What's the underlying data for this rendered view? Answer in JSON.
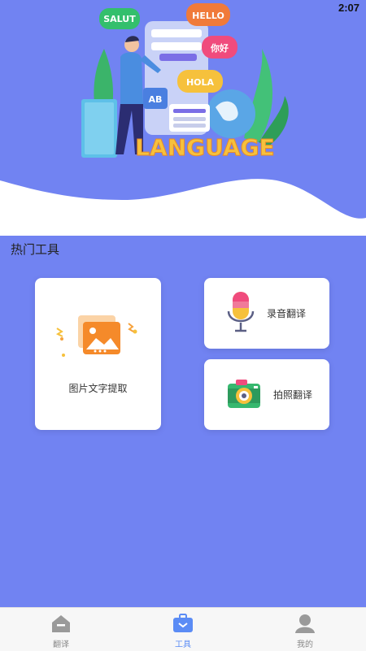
{
  "status_bar": {
    "time": "2:07"
  },
  "hero": {
    "bubbles": {
      "salut": "SALUT",
      "hello": "HELLO",
      "nihao": "你好",
      "hola": "HOLA",
      "ab": "AB"
    },
    "banner_text": "LANGUAGE",
    "colors": {
      "header_bg": "#7183f2",
      "accent_yellow": "#f6c13c"
    }
  },
  "section": {
    "title": "热门工具"
  },
  "tools": {
    "ocr": {
      "label": "图片文字提取",
      "icon": "image-text-icon"
    },
    "record": {
      "label": "录音翻译",
      "icon": "microphone-icon"
    },
    "camera": {
      "label": "拍照翻译",
      "icon": "camera-icon"
    }
  },
  "tabbar": {
    "items": [
      {
        "label": "翻译",
        "icon": "house-icon",
        "active": false
      },
      {
        "label": "工具",
        "icon": "toolbox-icon",
        "active": true
      },
      {
        "label": "我的",
        "icon": "person-icon",
        "active": false
      }
    ],
    "colors": {
      "active": "#5b8cf5",
      "inactive": "#8a8a8a"
    }
  }
}
